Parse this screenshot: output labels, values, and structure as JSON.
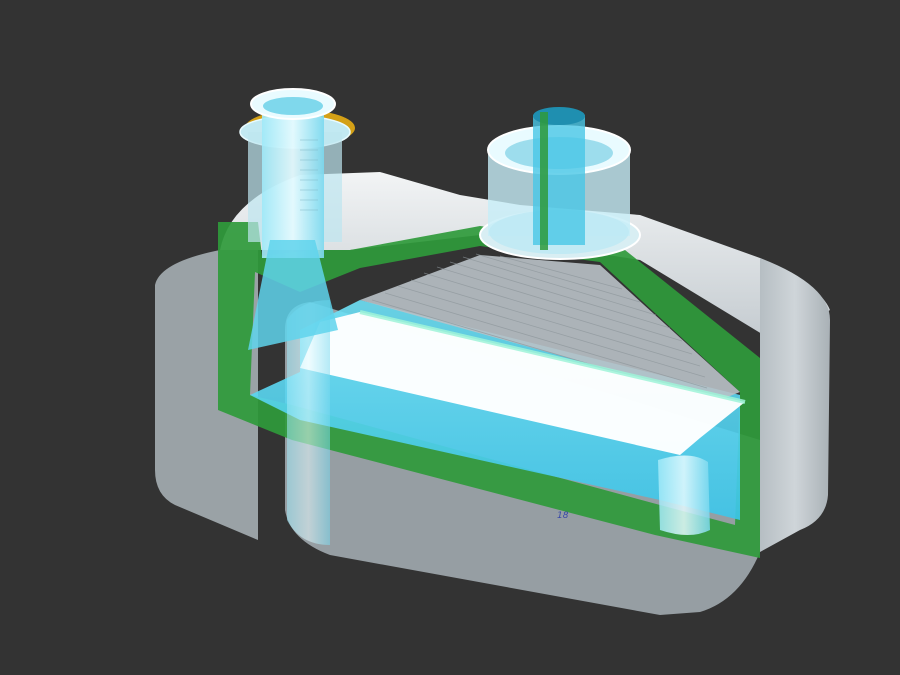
{
  "viewport": {
    "background": "#333333",
    "model": {
      "colors": {
        "housing": "#c9cfd3",
        "housing_shadow": "#8e979d",
        "section_cut": "#2f9a3b",
        "water": "#4fd6f2",
        "water_light": "#b8f1fb",
        "membrane_glow": "#ffffff",
        "accent_ring": "#d4a016"
      },
      "ports": [
        "inlet-port",
        "outlet-port"
      ],
      "annotation": "18"
    }
  }
}
